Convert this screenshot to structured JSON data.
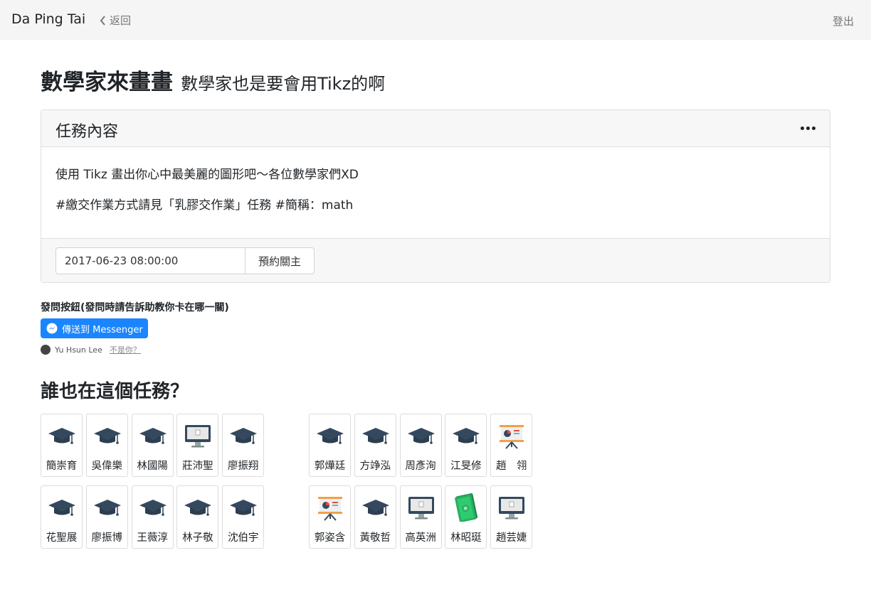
{
  "navbar": {
    "brand": "Da Ping Tai",
    "back_label": "返回",
    "logout_label": "登出"
  },
  "task": {
    "title": "數學家來畫畫",
    "subtitle": "數學家也是要會用Tikz的啊",
    "card_header": "任務內容",
    "description_1": "使用 Tikz 畫出你心中最美麗的圖形吧～各位數學家們XD",
    "description_2": "#繳交作業方式請見「乳膠交作業」任務 #簡稱：math",
    "datetime_value": "2017-06-23 08:00:00",
    "reserve_button": "預約關主"
  },
  "ask": {
    "label": "發問按鈕(發問時請告訴助教你卡在哪一關)",
    "messenger_button": "傳送到 Messenger",
    "user_name": "Yu Hsun Lee",
    "not_you": "不是你？"
  },
  "who": {
    "title": "誰也在這個任務？",
    "groups": [
      {
        "rows": [
          [
            {
              "name": "簡崇育",
              "icon": "graduation-cap-icon"
            },
            {
              "name": "吳偉樂",
              "icon": "graduation-cap-icon"
            },
            {
              "name": "林國陽",
              "icon": "graduation-cap-icon"
            },
            {
              "name": "莊沛聖",
              "icon": "monitor-icon"
            },
            {
              "name": "廖振翔",
              "icon": "graduation-cap-icon"
            }
          ],
          [
            {
              "name": "花聖展",
              "icon": "graduation-cap-icon"
            },
            {
              "name": "廖振博",
              "icon": "graduation-cap-icon"
            },
            {
              "name": "王薇淳",
              "icon": "graduation-cap-icon"
            },
            {
              "name": "林子敬",
              "icon": "graduation-cap-icon"
            },
            {
              "name": "沈伯宇",
              "icon": "graduation-cap-icon"
            }
          ]
        ]
      },
      {
        "rows": [
          [
            {
              "name": "郭燁廷",
              "icon": "graduation-cap-icon"
            },
            {
              "name": "方竫泓",
              "icon": "graduation-cap-icon"
            },
            {
              "name": "周彥洵",
              "icon": "graduation-cap-icon"
            },
            {
              "name": "江旻修",
              "icon": "graduation-cap-icon"
            },
            {
              "name": "趙　翎",
              "icon": "presentation-board-icon"
            }
          ],
          [
            {
              "name": "郭姿含",
              "icon": "presentation-board-icon"
            },
            {
              "name": "黃敬哲",
              "icon": "graduation-cap-icon"
            },
            {
              "name": "高英洲",
              "icon": "monitor-icon"
            },
            {
              "name": "林昭珽",
              "icon": "money-icon"
            },
            {
              "name": "趙芸婕",
              "icon": "monitor-icon"
            }
          ]
        ]
      }
    ]
  },
  "colors": {
    "navbar_bg": "#f5f5f5",
    "messenger_blue": "#1a85ff",
    "card_header_bg": "#f7f7f7",
    "icon_dark": "#34495e",
    "money_green": "#2ecc71"
  }
}
